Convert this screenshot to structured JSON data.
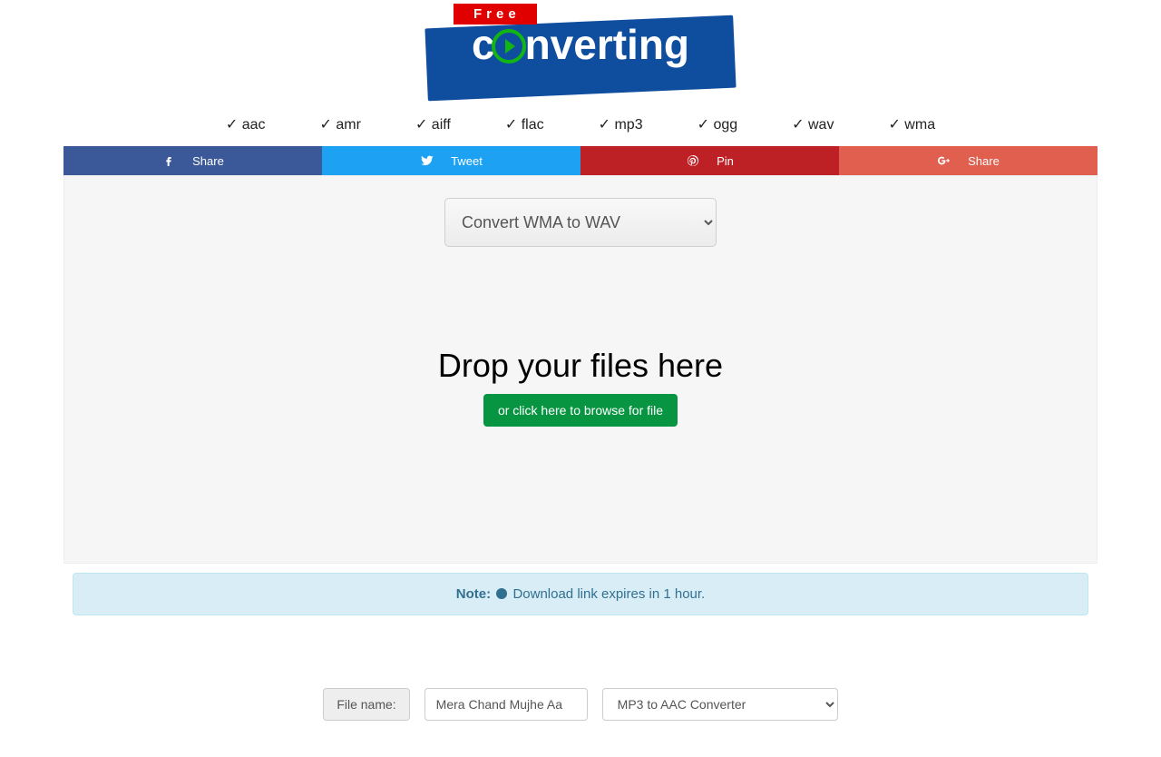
{
  "logo": {
    "free": "Free",
    "word_rest": "nverting"
  },
  "formats": [
    "✓ aac",
    "✓ amr",
    "✓ aiff",
    "✓ flac",
    "✓ mp3",
    "✓ ogg",
    "✓ wav",
    "✓ wma"
  ],
  "share": {
    "fb": "Share",
    "tw": "Tweet",
    "pn": "Pin",
    "gp": "Share"
  },
  "convert_select": "Convert WMA to WAV",
  "dropzone": {
    "title": "Drop your files here",
    "browse": "or click here to browse for file"
  },
  "note": {
    "label": "Note:",
    "text": "Download link expires in 1 hour."
  },
  "form": {
    "addon": "File name:",
    "filename": "Mera Chand Mujhe Aa",
    "target_select": "MP3 to AAC Converter"
  }
}
